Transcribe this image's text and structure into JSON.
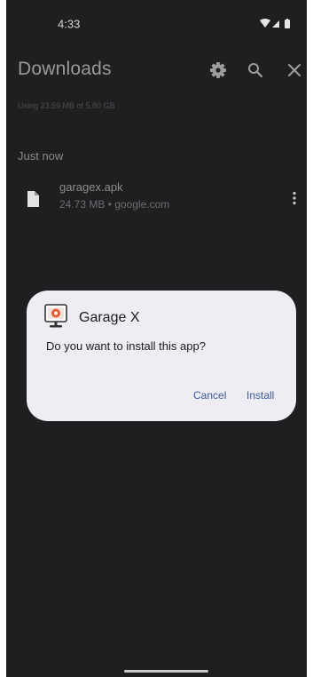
{
  "status_bar": {
    "time": "4:33"
  },
  "toolbar": {
    "title": "Downloads",
    "icons": [
      "gear-icon",
      "search-icon",
      "close-icon"
    ]
  },
  "storage": {
    "text": "Using 23.59 MB of 5.80 GB"
  },
  "sections": [
    {
      "header": "Just now",
      "files": [
        {
          "name": "garagex.apk",
          "meta": "24.73 MB • google.com",
          "icon": "file-icon"
        }
      ]
    }
  ],
  "dialog": {
    "app_name": "Garage X",
    "message": "Do you want to install this app?",
    "cancel_label": "Cancel",
    "install_label": "Install"
  },
  "colors": {
    "background": "#1f1f21",
    "dialog_surface": "#ededf3",
    "dialog_button": "#3e5a9e"
  }
}
